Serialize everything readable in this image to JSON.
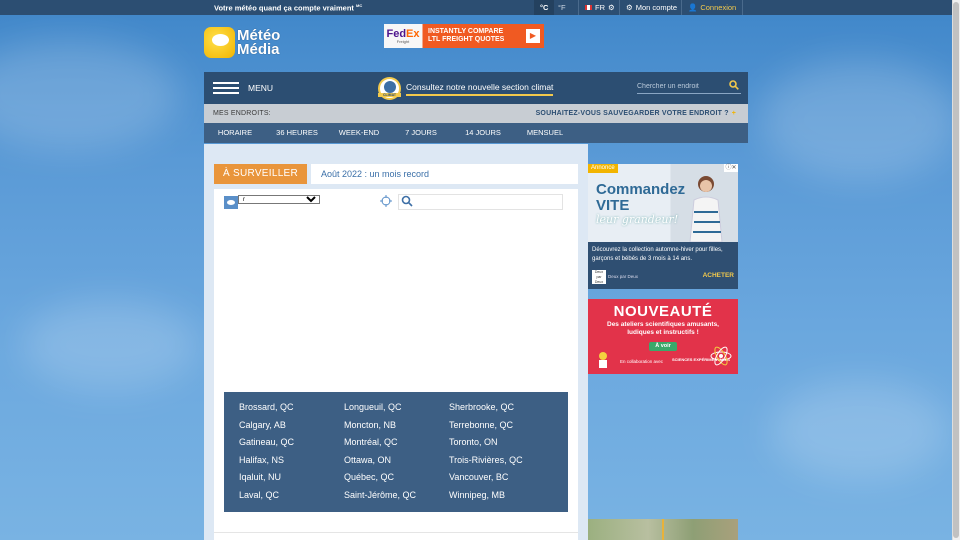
{
  "topbar": {
    "tagline": "Votre météo quand ça compte vraiment",
    "tagline_mark": "MC",
    "unit_c": "°C",
    "unit_f": "°F",
    "lang": "FR",
    "account": "Mon compte",
    "login": "Connexion"
  },
  "logo": {
    "line1": "Météo",
    "line2": "Média"
  },
  "fedex_ad": {
    "brand_a": "Fed",
    "brand_b": "Ex",
    "sub": "Freight",
    "text_line1": "INSTANTLY COMPARE",
    "text_line2": "LTL FREIGHT QUOTES",
    "arrow": "▶"
  },
  "menubar": {
    "menu": "MENU",
    "climat_badge": "CLIMAT",
    "climat_link": "Consultez notre nouvelle section climat",
    "search_placeholder": "Chercher un endroit"
  },
  "places": {
    "label": "MES ENDROITS:",
    "save_prompt": "SOUHAITEZ-VOUS SAUVEGARDER VOTRE ENDROIT ?",
    "plus": "+"
  },
  "tabs": [
    "HORAIRE",
    "36 HEURES",
    "WEEK-END",
    "7 JOURS",
    "14 JOURS",
    "MENSUEL"
  ],
  "watch": {
    "tag": "À SURVEILLER",
    "link": "Août 2022 : un mois record"
  },
  "map": {
    "select_value": "r"
  },
  "cities": [
    "Brossard, QC",
    "Longueuil, QC",
    "Sherbrooke, QC",
    "Calgary, AB",
    "Moncton, NB",
    "Terrebonne, QC",
    "Gatineau, QC",
    "Montréal, QC",
    "Toronto, ON",
    "Halifax, NS",
    "Ottawa, ON",
    "Trois-Rivières, QC",
    "Iqaluit, NU",
    "Québec, QC",
    "Vancouver, BC",
    "Laval, QC",
    "Saint-Jérôme, QC",
    "Winnipeg, MB"
  ],
  "knit_ad": {
    "tag": "Annonce",
    "close": "ⓘ✕",
    "head1": "Commandez",
    "head2": "VITE",
    "head3": "leur grandeur!",
    "desc": "Découvrez la collection automne-hiver pour filles, garçons et bébés de 3 mois à 14 ans.",
    "brand_logo": "Deux par Deux",
    "brand_name": "Deux par Deux",
    "buy": "ACHETER"
  },
  "sci_ad": {
    "title": "NOUVEAUTÉ",
    "sub": "Des ateliers scientifiques amusants, ludiques et instructifs !",
    "button": "À voir",
    "collab": "En collaboration avec",
    "partner": "SCIENCES EXPÉRIMENTALES"
  },
  "colors": {
    "navy": "#2c4e72",
    "tab_blue": "#3d5f84",
    "accent_yellow": "#f2c94c",
    "orange_tag": "#e9953b",
    "fedex_orange": "#f05a22",
    "sci_red": "#e2334a"
  }
}
